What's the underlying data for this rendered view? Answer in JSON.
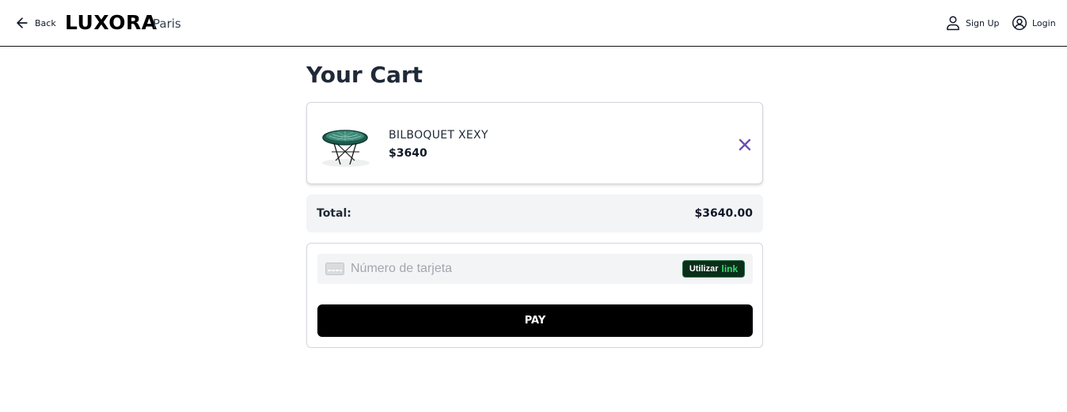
{
  "header": {
    "back_label": "Back",
    "brand": "LUXORA",
    "city": "Paris",
    "signup_label": "Sign Up",
    "login_label": "Login"
  },
  "cart": {
    "title": "Your Cart",
    "items": [
      {
        "name": "BILBOQUET XEXY",
        "price": "$3640",
        "image": "green woven side table"
      }
    ],
    "total_label": "Total:",
    "total_value": "$3640.00"
  },
  "payment": {
    "card_placeholder": "Número de tarjeta",
    "card_value": "",
    "link_prefix": "Utilizar",
    "link_word": "link",
    "pay_label": "PAY"
  },
  "icons": {
    "back": "arrow-left-icon",
    "signup": "user-icon",
    "login": "user-circle-icon",
    "remove": "close-icon",
    "card": "credit-card-icon"
  },
  "colors": {
    "remove_accent": "#6d4fb3",
    "link_bg": "#0a2e1a",
    "link_green": "#33dd6a",
    "pay_bg": "#000000"
  }
}
